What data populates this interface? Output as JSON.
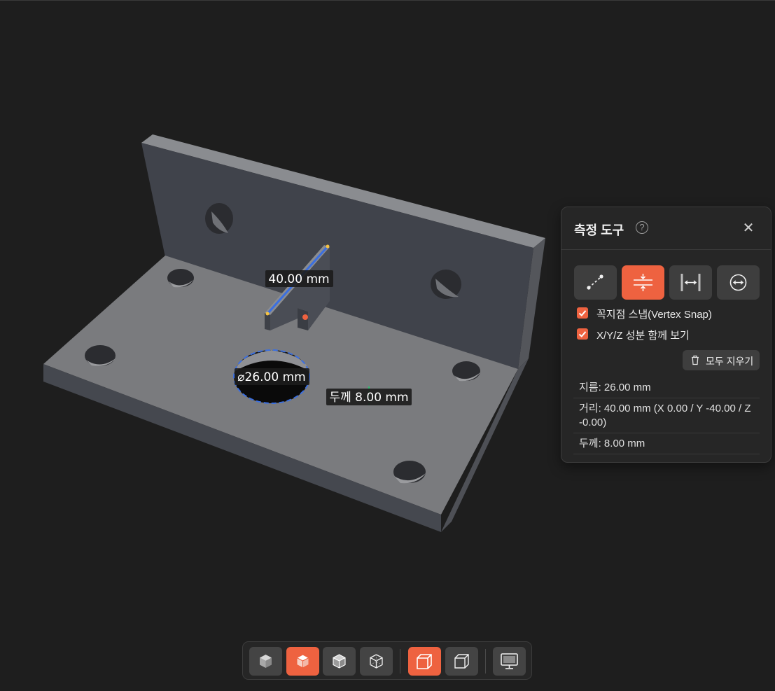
{
  "viewport": {
    "labels": {
      "distance": "40.00 mm",
      "diameter": "⌀26.00 mm",
      "thickness": "두께 8.00 mm"
    }
  },
  "panel": {
    "title": "측정 도구",
    "help_icon": "?",
    "close_icon": "✕",
    "tools": [
      {
        "icon": "point-to-point-distance-icon",
        "active": false
      },
      {
        "icon": "thickness-icon",
        "active": true
      },
      {
        "icon": "edge-length-icon",
        "active": false
      },
      {
        "icon": "diameter-icon",
        "active": false
      }
    ],
    "options": {
      "vertex_snap": {
        "label": "꼭지점 스냅(Vertex Snap)",
        "checked": true
      },
      "xyz_components": {
        "label": "X/Y/Z 성분 함께 보기",
        "checked": true
      }
    },
    "clear_all_label": "모두 지우기",
    "results": [
      "지름: 26.00 mm",
      "거리: 40.00 mm (X 0.00 / Y -40.00 / Z -0.00)",
      "두께: 8.00 mm"
    ]
  },
  "toolbar": {
    "buttons": [
      {
        "icon": "shaded-cube-icon",
        "active": false
      },
      {
        "icon": "shaded-edges-cube-icon",
        "active": true
      },
      {
        "icon": "hidden-line-cube-icon",
        "active": false
      },
      {
        "icon": "wireframe-cube-icon",
        "active": false
      },
      {
        "icon": "perspective-view-icon",
        "active": true
      },
      {
        "icon": "orthographic-view-icon",
        "active": false
      },
      {
        "icon": "monitor-icon",
        "active": false
      }
    ]
  },
  "colors": {
    "accent": "#ee6240",
    "background": "#1e1e1e",
    "panel": "#262626",
    "measure_line": "#3b6fe0"
  }
}
